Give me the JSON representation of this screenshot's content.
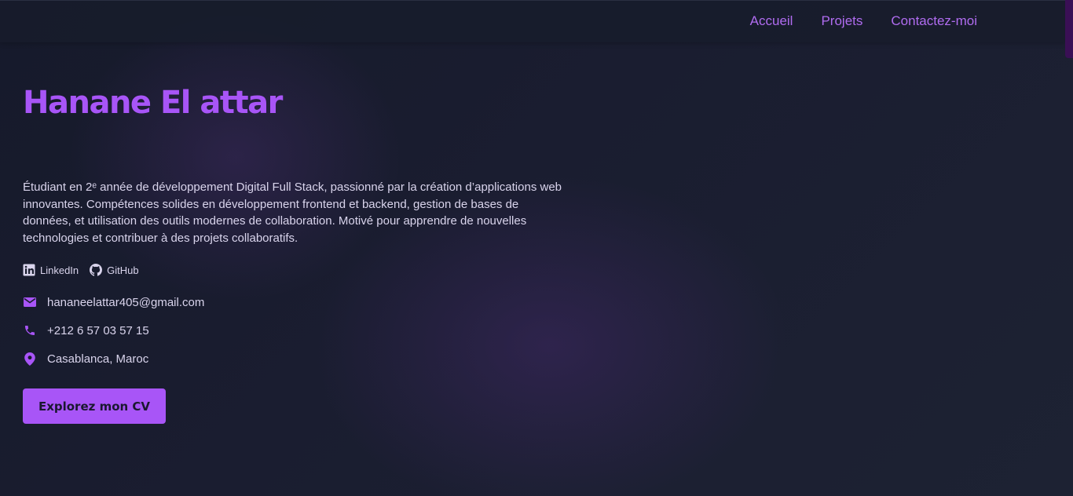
{
  "nav": {
    "items": [
      {
        "label": "Accueil"
      },
      {
        "label": "Projets"
      },
      {
        "label": "Contactez-moi"
      }
    ]
  },
  "hero": {
    "name": "Hanane El attar",
    "description": "Étudiant en 2ᵉ année de développement Digital Full Stack, passionné par la création d’applications web innovantes. Compétences solides en développement frontend et backend, gestion de bases de données, et utilisation des outils modernes de collaboration. Motivé pour apprendre de nouvelles technologies et contribuer à des projets collaboratifs.",
    "social": {
      "linkedin_label": "LinkedIn",
      "github_label": "GitHub"
    },
    "contact": {
      "email": "hananeelattar405@gmail.com",
      "phone": "+212 6 57 03 57 15",
      "location": "Casablanca, Maroc"
    },
    "cta_label": "Explorez mon CV"
  },
  "icons": {
    "social": [
      "linkedin-icon",
      "github-icon"
    ],
    "contact": [
      "envelope-icon",
      "phone-icon",
      "location-pin-icon"
    ]
  },
  "colors": {
    "accent": "#a855f7",
    "background": "#181c2c",
    "text": "#d9d4ec"
  }
}
